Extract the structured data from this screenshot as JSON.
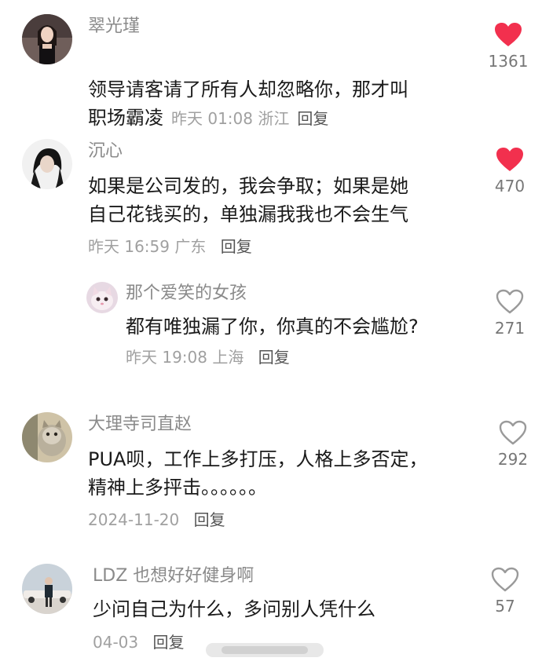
{
  "comments": [
    {
      "username": "翠光瑾",
      "text": "领导请客请了所有人却忽略你，那才叫\n职场霸凌",
      "time": "昨天 01:08",
      "location": "浙江",
      "reply_label": "回复",
      "likes": "1361",
      "liked": true
    },
    {
      "username": "沉心",
      "text": "如果是公司发的，我会争取；如果是她\n自己花钱买的，单独漏我我也不会生气",
      "time": "昨天 16:59",
      "location": "广东",
      "reply_label": "回复",
      "likes": "470",
      "liked": true
    },
    {
      "username": "那个爱笑的女孩",
      "text": "都有唯独漏了你，你真的不会尴尬?",
      "time": "昨天 19:08",
      "location": "上海",
      "reply_label": "回复",
      "likes": "271",
      "liked": false
    },
    {
      "username": "大理寺司直赵",
      "text": "PUA呗，工作上多打压，人格上多否定，\n精神上多抨击。。。。。。",
      "time": "2024-11-20",
      "location": "",
      "reply_label": "回复",
      "likes": "292",
      "liked": false
    },
    {
      "username": "LDZ 也想好好健身啊",
      "text": "少问自己为什么，多问别人凭什么",
      "time": "04-03",
      "location": "",
      "reply_label": "回复",
      "likes": "57",
      "liked": false
    }
  ],
  "colors": {
    "liked_heart": "#f2304e",
    "unliked_heart": "#9a9a9a",
    "username": "#8a8a8a",
    "text": "#1a1a1a",
    "meta": "#a0a0a0"
  },
  "icons": {
    "like_active": "heart-filled-icon",
    "like_inactive": "heart-outline-icon"
  }
}
